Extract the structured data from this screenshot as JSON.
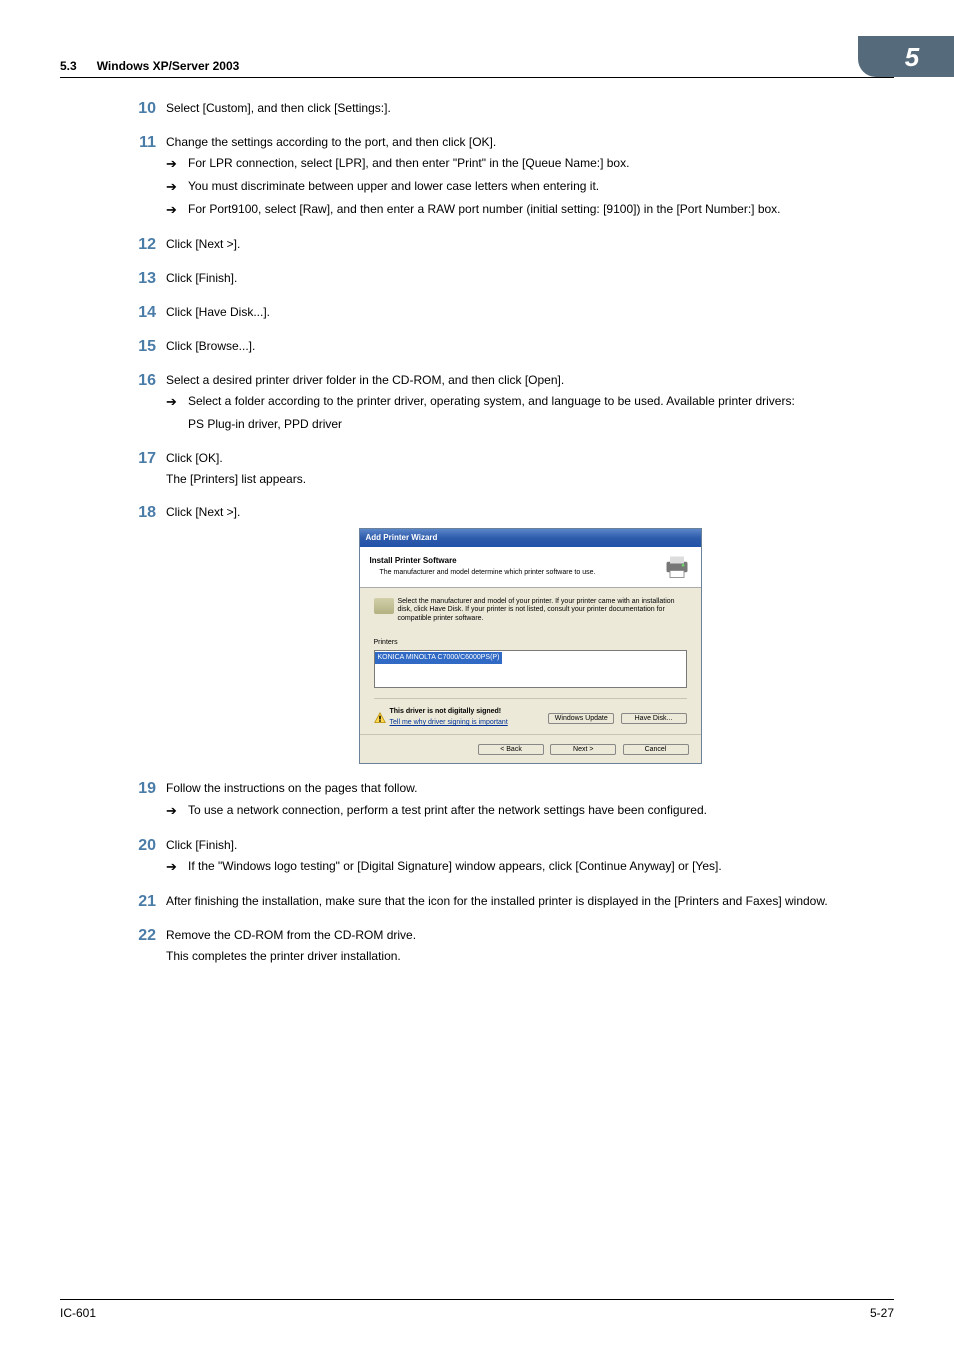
{
  "header": {
    "section_num": "5.3",
    "section_title": "Windows XP/Server 2003",
    "chapter_badge": "5"
  },
  "steps": [
    {
      "num": "10",
      "text": "Select [Custom], and then click [Settings:].",
      "subs": []
    },
    {
      "num": "11",
      "text": "Change the settings according to the port, and then click [OK].",
      "subs": [
        "For LPR connection, select [LPR], and then enter \"Print\" in the [Queue Name:] box.",
        "You must discriminate between upper and lower case letters when entering it.",
        "For Port9100, select [Raw], and then enter a RAW port number (initial setting: [9100]) in the [Port Number:] box."
      ]
    },
    {
      "num": "12",
      "text": "Click [Next >].",
      "subs": []
    },
    {
      "num": "13",
      "text": "Click [Finish].",
      "subs": []
    },
    {
      "num": "14",
      "text": "Click [Have Disk...].",
      "subs": []
    },
    {
      "num": "15",
      "text": "Click [Browse...].",
      "subs": []
    },
    {
      "num": "16",
      "text": "Select a desired printer driver folder in the CD-ROM, and then click [Open].",
      "subs": [
        "Select a folder according to the printer driver, operating system, and language to be used. Available printer drivers:"
      ],
      "trailing": "PS Plug-in driver, PPD driver"
    },
    {
      "num": "17",
      "text": "Click [OK].",
      "note": "The [Printers] list appears.",
      "subs": []
    },
    {
      "num": "18",
      "text": "Click [Next >].",
      "subs": [],
      "has_wizard": true
    },
    {
      "num": "19",
      "text": "Follow the instructions on the pages that follow.",
      "subs": [
        "To use a network connection, perform a test print after the network settings have been configured."
      ]
    },
    {
      "num": "20",
      "text": "Click [Finish].",
      "subs": [
        "If the \"Windows logo testing\" or [Digital Signature] window appears, click [Continue Anyway] or [Yes]."
      ]
    },
    {
      "num": "21",
      "text": "After finishing the installation, make sure that the icon for the installed printer is displayed in the [Printers and Faxes] window.",
      "subs": []
    },
    {
      "num": "22",
      "text": "Remove the CD-ROM from the CD-ROM drive.",
      "note": "This completes the printer driver installation.",
      "subs": []
    }
  ],
  "wizard": {
    "title": "Add Printer Wizard",
    "head_bold": "Install Printer Software",
    "head_sub": "The manufacturer and model determine which printer software to use.",
    "info": "Select the manufacturer and model of your printer. If your printer came with an installation disk, click Have Disk. If your printer is not listed, consult your printer documentation for compatible printer software.",
    "printers_label": "Printers",
    "printers_item": "KONICA MINOLTA C7000/C6000PS(P)",
    "sign_bold": "This driver is not digitally signed!",
    "sign_link": "Tell me why driver signing is important",
    "windows_update": "Windows Update",
    "have_disk": "Have Disk...",
    "back": "< Back",
    "next": "Next >",
    "cancel": "Cancel"
  },
  "footer": {
    "left": "IC-601",
    "right": "5-27"
  }
}
